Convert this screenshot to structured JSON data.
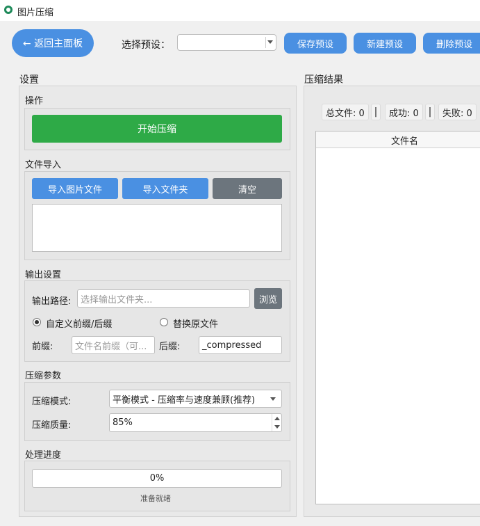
{
  "window": {
    "title": "图片压缩"
  },
  "toolbar": {
    "back_label": "← 返回主面板",
    "preset_label": "选择预设：",
    "preset_value": "",
    "save_preset": "保存预设",
    "new_preset": "新建预设",
    "delete_preset": "删除预设"
  },
  "settings": {
    "title": "设置",
    "operation": {
      "title": "操作",
      "start_button": "开始压缩"
    },
    "file_import": {
      "title": "文件导入",
      "import_images": "导入图片文件",
      "import_folder": "导入文件夹",
      "clear": "清空"
    },
    "output": {
      "title": "输出设置",
      "path_label": "输出路径:",
      "path_placeholder": "选择输出文件夹...",
      "browse": "浏览",
      "radio_custom": "自定义前缀/后缀",
      "radio_replace": "替换原文件",
      "radio_selected": "custom",
      "prefix_label": "前缀:",
      "prefix_placeholder": "文件名前缀（可...",
      "suffix_label": "后缀:",
      "suffix_value": "_compressed"
    },
    "params": {
      "title": "压缩参数",
      "mode_label": "压缩模式:",
      "mode_value": "平衡模式 - 压缩率与速度兼顾(推荐)",
      "quality_label": "压缩质量:",
      "quality_value": "85%"
    },
    "progress": {
      "title": "处理进度",
      "percent_text": "0%",
      "progress_fraction": 0,
      "status": "准备就绪"
    }
  },
  "results": {
    "title": "压缩结果",
    "total": "总文件: 0",
    "separator": "|",
    "success": "成功: 0",
    "failed": "失败: 0",
    "column_filename": "文件名"
  },
  "colors": {
    "accent_blue": "#4a90e2",
    "start_green": "#2eaa47",
    "clear_gray": "#6c757d"
  }
}
